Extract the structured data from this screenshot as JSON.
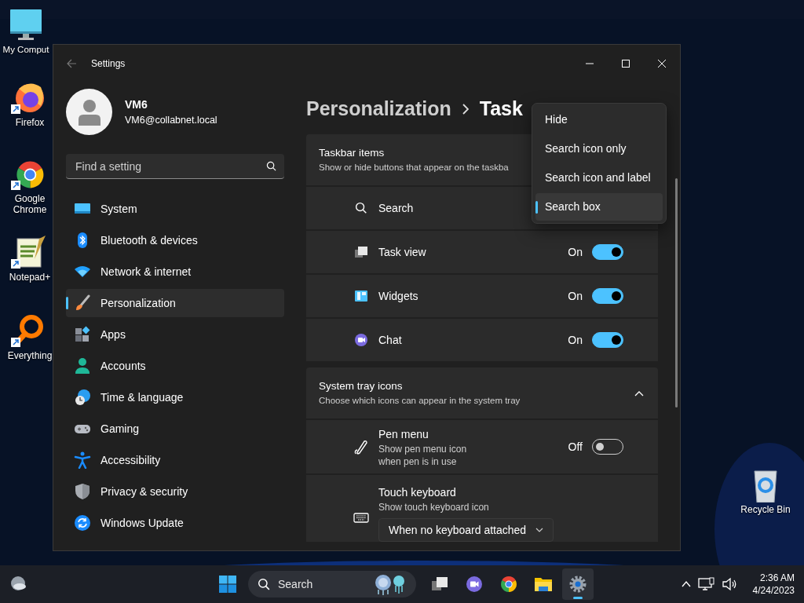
{
  "desktop_icons": [
    {
      "label": "My Comput"
    },
    {
      "label": "Firefox"
    },
    {
      "label": "Google Chrome"
    },
    {
      "label": "Notepad+"
    },
    {
      "label": "Everything"
    },
    {
      "label": "Recycle Bin"
    }
  ],
  "window": {
    "title": "Settings",
    "user": {
      "name": "VM6",
      "email": "VM6@collabnet.local"
    },
    "search": {
      "placeholder": "Find a setting"
    },
    "nav": [
      {
        "label": "System",
        "selected": false
      },
      {
        "label": "Bluetooth & devices",
        "selected": false
      },
      {
        "label": "Network & internet",
        "selected": false
      },
      {
        "label": "Personalization",
        "selected": true
      },
      {
        "label": "Apps",
        "selected": false
      },
      {
        "label": "Accounts",
        "selected": false
      },
      {
        "label": "Time & language",
        "selected": false
      },
      {
        "label": "Gaming",
        "selected": false
      },
      {
        "label": "Accessibility",
        "selected": false
      },
      {
        "label": "Privacy & security",
        "selected": false
      },
      {
        "label": "Windows Update",
        "selected": false
      }
    ],
    "breadcrumb": {
      "parent": "Personalization",
      "current": "Task"
    },
    "sections": [
      {
        "title": "Taskbar items",
        "subtitle": "Show or hide buttons that appear on the taskba",
        "items": [
          {
            "kind": "menu",
            "label": "Search"
          },
          {
            "kind": "toggle",
            "label": "Task view",
            "state_label": "On",
            "on": true
          },
          {
            "kind": "toggle",
            "label": "Widgets",
            "state_label": "On",
            "on": true
          },
          {
            "kind": "toggle",
            "label": "Chat",
            "state_label": "On",
            "on": true
          }
        ]
      },
      {
        "title": "System tray icons",
        "subtitle": "Choose which icons can appear in the system tray",
        "expanded": true,
        "items": [
          {
            "kind": "toggle",
            "label": "Pen menu",
            "description": "Show pen menu icon\nwhen pen is in use",
            "state_label": "Off",
            "on": false
          },
          {
            "kind": "select",
            "label": "Touch keyboard",
            "description": "Show touch keyboard icon",
            "value": "When no keyboard attached"
          }
        ]
      }
    ],
    "dropdown_menu": {
      "options": [
        {
          "label": "Hide",
          "selected": false
        },
        {
          "label": "Search icon only",
          "selected": false
        },
        {
          "label": "Search icon and label",
          "selected": false
        },
        {
          "label": "Search box",
          "selected": true
        }
      ]
    }
  },
  "taskbar": {
    "search": {
      "placeholder": "Search"
    },
    "apps": [
      {
        "active": false
      },
      {
        "active": false
      },
      {
        "active": false
      },
      {
        "active": false
      },
      {
        "active": true
      }
    ],
    "clock": {
      "time": "2:36 AM",
      "date": "4/24/2023"
    }
  }
}
